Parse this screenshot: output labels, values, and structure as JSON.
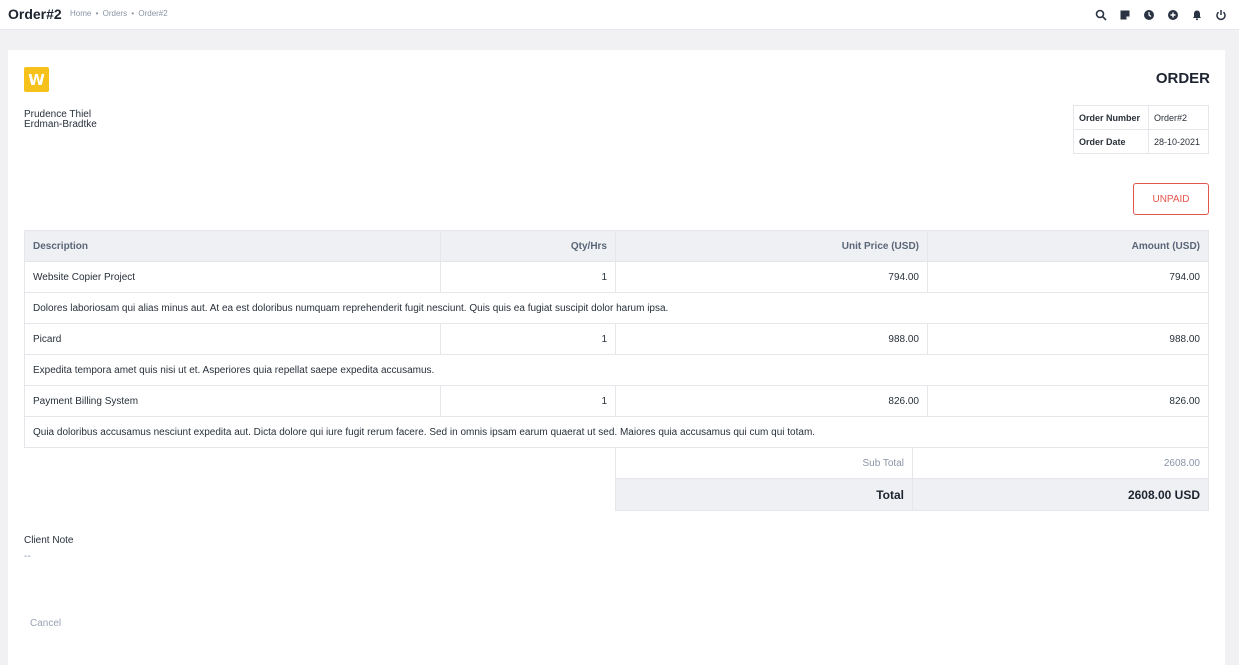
{
  "header": {
    "title": "Order#2",
    "breadcrumb": [
      "Home",
      "Orders",
      "Order#2"
    ],
    "breadcrumb_separator": "•",
    "icons": [
      "search-icon",
      "note-icon",
      "clock-icon",
      "add-circle-icon",
      "bell-icon",
      "power-icon"
    ]
  },
  "document": {
    "logo_letter": "W",
    "logo_color": "#f7c11c",
    "client_name": "Prudence Thiel",
    "company": "Erdman-Bradtke",
    "title": "ORDER",
    "meta": [
      {
        "label": "Order Number",
        "value": "Order#2"
      },
      {
        "label": "Order Date",
        "value": "28-10-2021"
      }
    ],
    "status": "UNPAID",
    "status_color": "#e2564d"
  },
  "table": {
    "headers": {
      "description": "Description",
      "qty": "Qty/Hrs",
      "unit_price": "Unit Price (USD)",
      "amount": "Amount (USD)"
    },
    "items": [
      {
        "name": "Website Copier Project",
        "qty": "1",
        "unit_price": "794.00",
        "amount": "794.00",
        "description": "Dolores laboriosam qui alias minus aut. At ea est doloribus numquam reprehenderit fugit nesciunt. Quis quis ea fugiat suscipit dolor harum ipsa."
      },
      {
        "name": "Picard",
        "qty": "1",
        "unit_price": "988.00",
        "amount": "988.00",
        "description": "Expedita tempora amet quis nisi ut et. Asperiores quia repellat saepe expedita accusamus."
      },
      {
        "name": "Payment Billing System",
        "qty": "1",
        "unit_price": "826.00",
        "amount": "826.00",
        "description": "Quia doloribus accusamus nesciunt expedita aut. Dicta dolore qui iure fugit rerum facere. Sed in omnis ipsam earum quaerat ut sed. Maiores quia accusamus qui cum qui totam."
      }
    ]
  },
  "totals": {
    "subtotal_label": "Sub Total",
    "subtotal_value": "2608.00",
    "total_label": "Total",
    "total_value": "2608.00 USD"
  },
  "note": {
    "label": "Client Note",
    "value": "--"
  },
  "footer": {
    "cancel_label": "Cancel"
  }
}
